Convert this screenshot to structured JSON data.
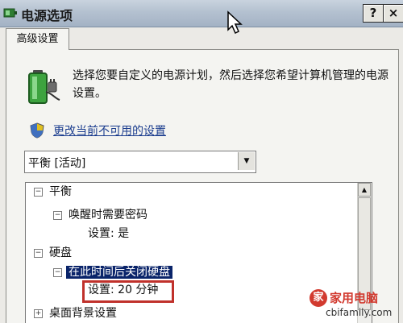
{
  "window": {
    "title": "电源选项",
    "help_label": "?",
    "close_label": "×"
  },
  "tab": {
    "label": "高级设置"
  },
  "description": "选择您要自定义的电源计划，然后选择您希望计算机管理的电源设置。",
  "link": "更改当前不可用的设置",
  "plan_select": {
    "value": "平衡 [活动]"
  },
  "tree": {
    "rows": [
      {
        "label": "平衡",
        "expander": "−"
      },
      {
        "label": "唤醒时需要密码",
        "expander": "−"
      },
      {
        "label": "设置: 是"
      },
      {
        "label": "硬盘",
        "expander": "−"
      },
      {
        "label": "在此时间后关闭硬盘",
        "expander": "−"
      },
      {
        "label": "设置: 20 分钟"
      },
      {
        "label": "桌面背景设置",
        "expander": "+"
      }
    ]
  },
  "watermark": {
    "name": "家用电脑",
    "url": "cbifamily.com"
  },
  "colors": {
    "selection": "#0a246a",
    "highlight_box": "#c0312b",
    "link": "#1a3c8e"
  }
}
